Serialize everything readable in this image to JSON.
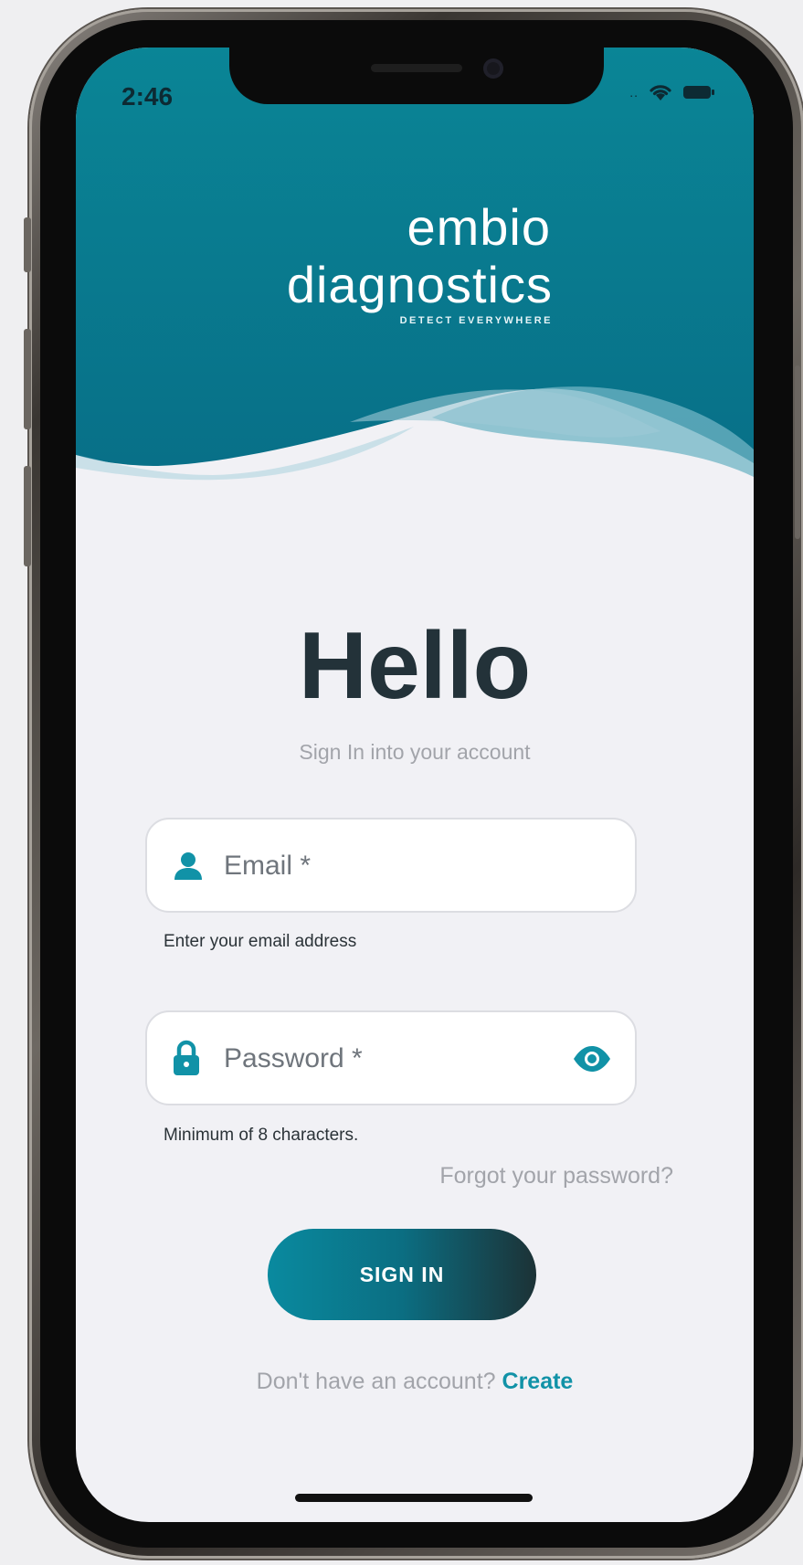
{
  "status_bar": {
    "time": "2:46"
  },
  "logo": {
    "line1": "embio",
    "line2": "diagnostics",
    "tagline": "DETECT EVERYWHERE"
  },
  "heading": "Hello",
  "subtitle": "Sign In into your account",
  "email": {
    "placeholder": "Email *",
    "value": "",
    "helper": "Enter your email address"
  },
  "password": {
    "placeholder": "Password *",
    "value": "",
    "helper": "Minimum of 8 characters."
  },
  "forgot_link": "Forgot your password?",
  "sign_in_button": "SIGN IN",
  "signup": {
    "prompt": "Don't have an account? ",
    "link": "Create"
  },
  "colors": {
    "accent": "#1192a7",
    "header": "#0a7f93",
    "heading_text": "#233239",
    "muted_text": "#a2a4aa",
    "background": "#f1f1f5"
  },
  "icons": {
    "email": "user-icon",
    "password": "lock-icon",
    "reveal": "eye-icon",
    "wifi": "wifi-icon",
    "battery": "battery-icon"
  }
}
